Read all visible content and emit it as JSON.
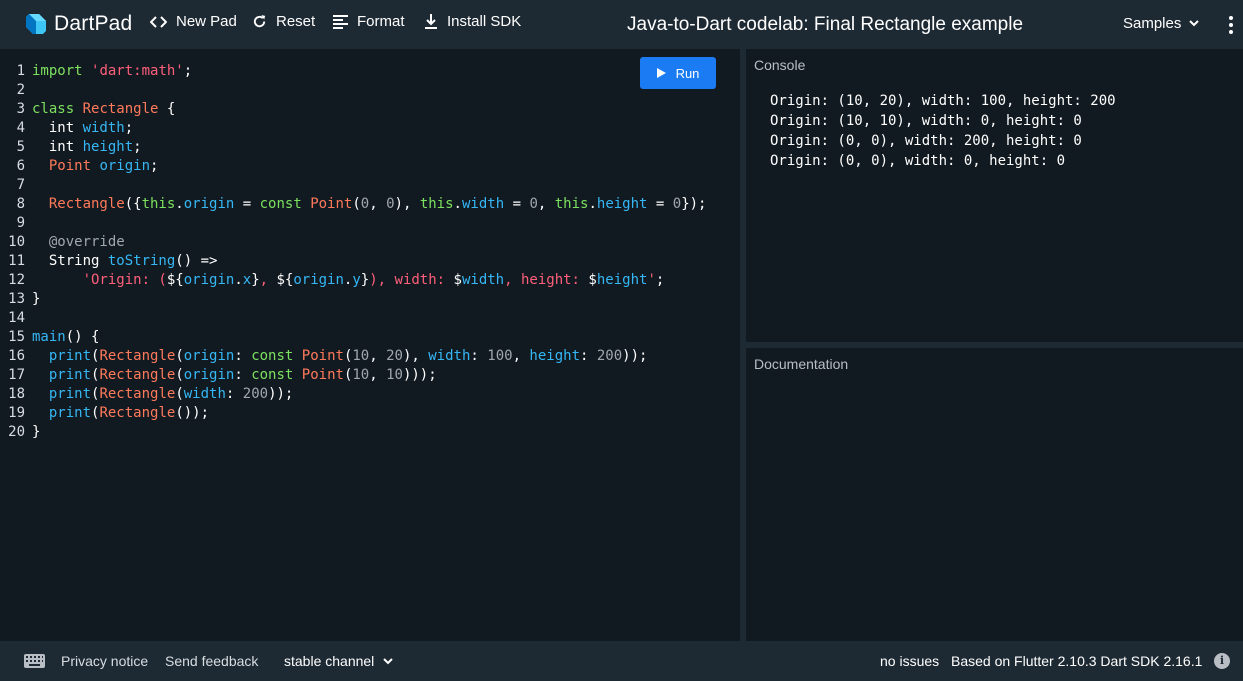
{
  "header": {
    "logo_text": "DartPad",
    "new_pad": "New Pad",
    "reset": "Reset",
    "format": "Format",
    "install_sdk": "Install SDK",
    "title": "Java-to-Dart codelab: Final Rectangle example",
    "samples": "Samples"
  },
  "editor": {
    "run_label": "Run",
    "line_numbers": [
      "1",
      "2",
      "3",
      "4",
      "5",
      "6",
      "7",
      "8",
      "9",
      "10",
      "11",
      "12",
      "13",
      "14",
      "15",
      "16",
      "17",
      "18",
      "19",
      "20"
    ]
  },
  "console": {
    "title": "Console",
    "lines": [
      "Origin: (10, 20), width: 100, height: 200",
      "Origin: (10, 10), width: 0, height: 0",
      "Origin: (0, 0), width: 200, height: 0",
      "Origin: (0, 0), width: 0, height: 0"
    ]
  },
  "docs": {
    "title": "Documentation"
  },
  "footer": {
    "privacy": "Privacy notice",
    "feedback": "Send feedback",
    "channel": "stable channel",
    "issues": "no issues",
    "version": "Based on Flutter 2.10.3 Dart SDK 2.16.1",
    "info_glyph": "i"
  },
  "colors": {
    "background": "#1e2a33",
    "editor_background": "#121a21",
    "run_button": "#1a7bf2",
    "keyword": "#7ce05f",
    "class_name": "#ff7a5a",
    "field": "#35b7f5",
    "string": "#ff5f7a",
    "number": "#a0a7ae"
  },
  "icons": {
    "logo": "dart-logo-icon",
    "new_pad": "code-brackets-icon",
    "reset": "refresh-icon",
    "format": "format-lines-icon",
    "install": "download-icon",
    "samples": "chevron-down-icon",
    "more": "more-vert-icon",
    "run": "play-icon",
    "keyboard": "keyboard-icon",
    "info": "info-icon"
  }
}
